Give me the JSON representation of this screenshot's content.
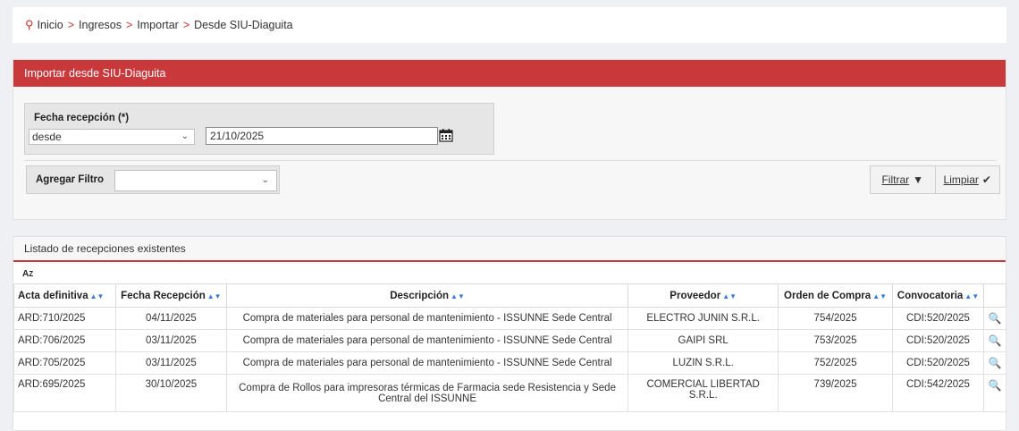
{
  "breadcrumb": {
    "items": [
      "Inicio",
      "Ingresos",
      "Importar",
      "Desde SIU-Diaguita"
    ],
    "separator": ">"
  },
  "panel": {
    "title": "Importar desde SIU-Diaguita",
    "fecha_label": "Fecha recepción (*)",
    "fecha_operator": "desde",
    "fecha_value": "21/10/2025",
    "agregar_label": "Agregar Filtro",
    "filtrar_label": "Filtrar",
    "limpiar_label": "Limpiar"
  },
  "list": {
    "title": "Listado de recepciones existentes",
    "sort_icon": "az-sort-icon",
    "columns": [
      "Acta definitiva",
      "Fecha Recepción",
      "Descripción",
      "Proveedor",
      "Orden de Compra",
      "Convocatoria"
    ],
    "rows": [
      {
        "acta": "ARD:710/2025",
        "fecha": "04/11/2025",
        "descripcion": "Compra de materiales para personal de mantenimiento - ISSUNNE Sede Central",
        "proveedor": "ELECTRO JUNIN S.R.L.",
        "orden": "754/2025",
        "convocatoria": "CDI:520/2025"
      },
      {
        "acta": "ARD:706/2025",
        "fecha": "03/11/2025",
        "descripcion": "Compra de materiales para personal de mantenimiento - ISSUNNE Sede Central",
        "proveedor": "GAIPI SRL",
        "orden": "753/2025",
        "convocatoria": "CDI:520/2025"
      },
      {
        "acta": "ARD:705/2025",
        "fecha": "03/11/2025",
        "descripcion": "Compra de materiales para personal de mantenimiento - ISSUNNE Sede Central",
        "proveedor": "LUZIN S.R.L.",
        "orden": "752/2025",
        "convocatoria": "CDI:520/2025"
      },
      {
        "acta": "ARD:695/2025",
        "fecha": "30/10/2025",
        "descripcion": "Compra de Rollos para impresoras térmicas de Farmacia sede Resistencia y Sede Central del ISSUNNE",
        "proveedor": "COMERCIAL LIBERTAD S.R.L.",
        "orden": "739/2025",
        "convocatoria": "CDI:542/2025"
      }
    ]
  },
  "colors": {
    "accent": "#c9383a",
    "sort_arrows": "#3a7bd5"
  }
}
